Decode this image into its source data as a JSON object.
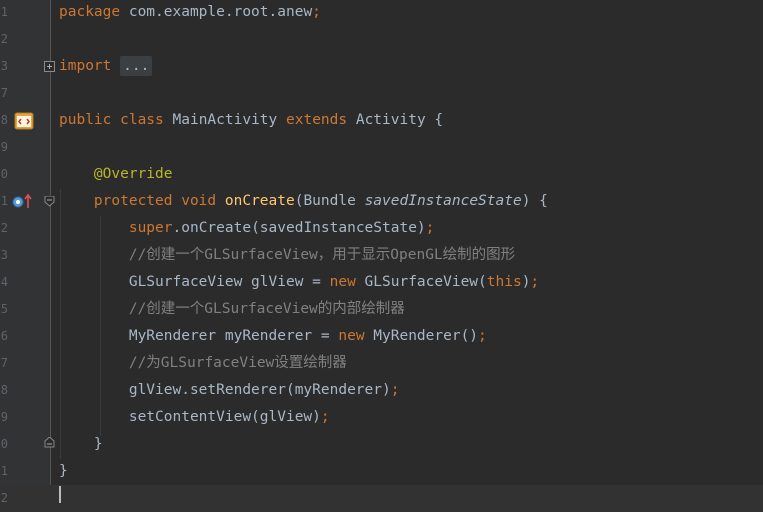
{
  "editor": {
    "language": "java",
    "current_line_index": 18,
    "lines": [
      {
        "number": "1",
        "segments": [
          {
            "t": "kw",
            "v": "package "
          },
          {
            "t": "plain",
            "v": "com.example.root.anew"
          },
          {
            "t": "kw",
            "v": ";"
          }
        ]
      },
      {
        "number": "2",
        "segments": []
      },
      {
        "number": "3",
        "segments": [
          {
            "t": "kw",
            "v": "import "
          },
          {
            "t": "fold",
            "v": "..."
          }
        ]
      },
      {
        "number": "7",
        "segments": []
      },
      {
        "number": "8",
        "segments": [
          {
            "t": "kw",
            "v": "public class "
          },
          {
            "t": "plain",
            "v": "MainActivity "
          },
          {
            "t": "kw",
            "v": "extends "
          },
          {
            "t": "plain",
            "v": "Activity {"
          }
        ]
      },
      {
        "number": "9",
        "segments": []
      },
      {
        "number": "0",
        "segments": [
          {
            "t": "plain",
            "v": "    "
          },
          {
            "t": "ann",
            "v": "@Override"
          }
        ]
      },
      {
        "number": "1",
        "segments": [
          {
            "t": "plain",
            "v": "    "
          },
          {
            "t": "kw",
            "v": "protected void "
          },
          {
            "t": "fn",
            "v": "onCreate"
          },
          {
            "t": "plain",
            "v": "(Bundle "
          },
          {
            "t": "param",
            "v": "savedInstanceState"
          },
          {
            "t": "plain",
            "v": ") {"
          }
        ]
      },
      {
        "number": "2",
        "segments": [
          {
            "t": "plain",
            "v": "        "
          },
          {
            "t": "kw",
            "v": "super"
          },
          {
            "t": "plain",
            "v": ".onCreate(savedInstanceState)"
          },
          {
            "t": "kw",
            "v": ";"
          }
        ]
      },
      {
        "number": "3",
        "segments": [
          {
            "t": "plain",
            "v": "        "
          },
          {
            "t": "cmt",
            "v": "//创建一个GLSurfaceView，用于显示OpenGL绘制的图形"
          }
        ]
      },
      {
        "number": "4",
        "segments": [
          {
            "t": "plain",
            "v": "        GLSurfaceView glView = "
          },
          {
            "t": "kw",
            "v": "new "
          },
          {
            "t": "plain",
            "v": "GLSurfaceView("
          },
          {
            "t": "kw",
            "v": "this"
          },
          {
            "t": "plain",
            "v": ")"
          },
          {
            "t": "kw",
            "v": ";"
          }
        ]
      },
      {
        "number": "5",
        "segments": [
          {
            "t": "plain",
            "v": "        "
          },
          {
            "t": "cmt",
            "v": "//创建一个GLSurfaceView的内部绘制器"
          }
        ]
      },
      {
        "number": "6",
        "segments": [
          {
            "t": "plain",
            "v": "        MyRenderer myRenderer = "
          },
          {
            "t": "kw",
            "v": "new "
          },
          {
            "t": "plain",
            "v": "MyRenderer()"
          },
          {
            "t": "kw",
            "v": ";"
          }
        ]
      },
      {
        "number": "7",
        "segments": [
          {
            "t": "plain",
            "v": "        "
          },
          {
            "t": "cmt",
            "v": "//为GLSurfaceView设置绘制器"
          }
        ]
      },
      {
        "number": "8",
        "segments": [
          {
            "t": "plain",
            "v": "        glView.setRenderer(myRenderer)"
          },
          {
            "t": "kw",
            "v": ";"
          }
        ]
      },
      {
        "number": "9",
        "segments": [
          {
            "t": "plain",
            "v": "        setContentView(glView)"
          },
          {
            "t": "kw",
            "v": ";"
          }
        ]
      },
      {
        "number": "0",
        "segments": [
          {
            "t": "plain",
            "v": "    }"
          }
        ]
      },
      {
        "number": "1",
        "segments": [
          {
            "t": "plain",
            "v": "}"
          }
        ]
      },
      {
        "number": "2",
        "segments": []
      }
    ]
  },
  "gutter_icons": {
    "line8": "android-activity-icon",
    "line11": "override-method-icon"
  },
  "colors": {
    "background": "#2b2b2b",
    "gutter": "#313335",
    "keyword": "#cc7832",
    "annotation": "#bbb529",
    "method": "#ffc66d",
    "comment": "#808080",
    "text": "#a9b7c6"
  }
}
